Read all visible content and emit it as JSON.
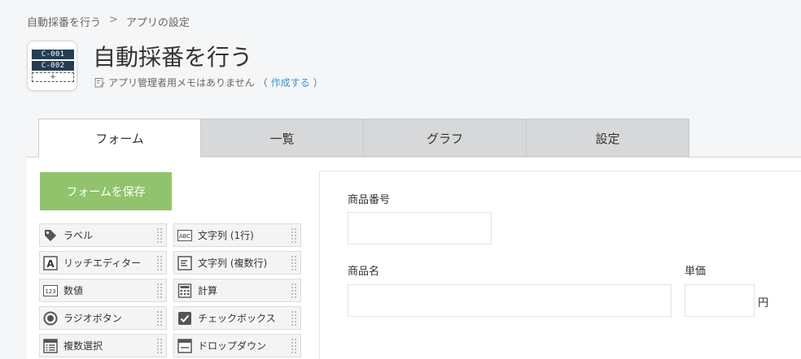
{
  "breadcrumb": {
    "app_link": "自動採番を行う",
    "separator": ">",
    "current": "アプリの設定"
  },
  "app": {
    "title": "自動採番を行う",
    "icon": {
      "code1": "C-001",
      "code2": "C-002",
      "plus": "+"
    },
    "memo_text": "アプリ管理者用メモはありません",
    "memo_paren_open": "（",
    "memo_link": "作成する",
    "memo_paren_close": "）"
  },
  "tabs": [
    {
      "label": "フォーム",
      "active": true
    },
    {
      "label": "一覧",
      "active": false
    },
    {
      "label": "グラフ",
      "active": false
    },
    {
      "label": "設定",
      "active": false
    }
  ],
  "form": {
    "save_label": "フォームを保存",
    "palette": [
      {
        "label": "ラベル",
        "icon": "tag-icon"
      },
      {
        "label": "文字列 (1行)",
        "icon": "abc-icon"
      },
      {
        "label": "リッチエディター",
        "icon": "rich-editor-icon"
      },
      {
        "label": "文字列 (複数行)",
        "icon": "multiline-text-icon"
      },
      {
        "label": "数値",
        "icon": "number-icon"
      },
      {
        "label": "計算",
        "icon": "calculator-icon"
      },
      {
        "label": "ラジオボタン",
        "icon": "radio-icon"
      },
      {
        "label": "チェックボックス",
        "icon": "checkbox-icon"
      },
      {
        "label": "複数選択",
        "icon": "multi-select-icon"
      },
      {
        "label": "ドロップダウン",
        "icon": "dropdown-icon"
      }
    ],
    "icon_texts": {
      "abc": "ABC",
      "a": "A",
      "num": "123"
    },
    "fields": {
      "product_number": {
        "label": "商品番号",
        "value": ""
      },
      "product_name": {
        "label": "商品名",
        "value": ""
      },
      "unit_price": {
        "label": "単価",
        "value": "",
        "unit": "円"
      }
    }
  },
  "colors": {
    "save_button": "#91c36c",
    "link": "#3498db",
    "icon_navy": "#233e54"
  }
}
